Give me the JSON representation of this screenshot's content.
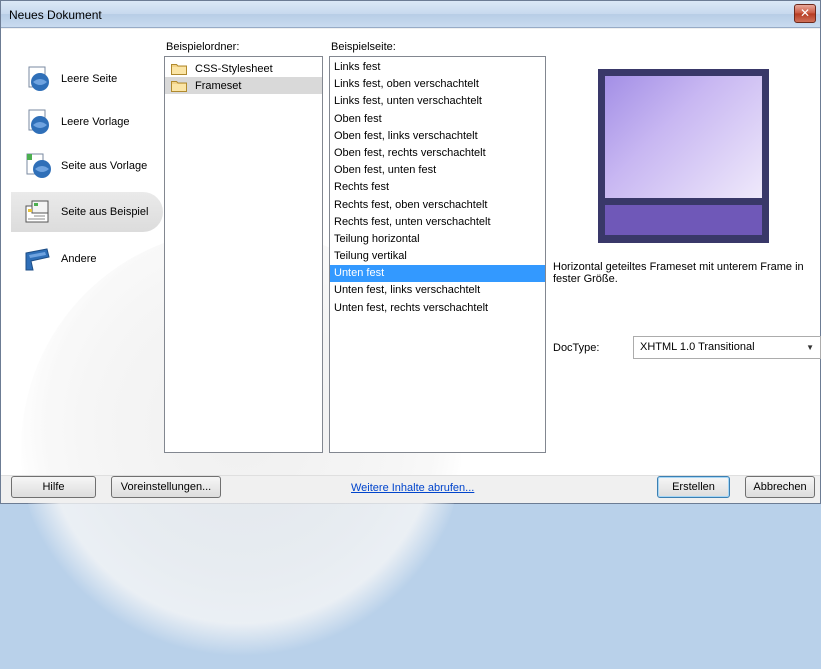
{
  "window": {
    "title": "Neues Dokument",
    "close_label": "✕"
  },
  "categories": [
    {
      "label": "Leere Seite",
      "icon": "blank-page-icon",
      "selected": false
    },
    {
      "label": "Leere Vorlage",
      "icon": "blank-template-icon",
      "selected": false
    },
    {
      "label": "Seite aus Vorlage",
      "icon": "page-from-template-icon",
      "selected": false
    },
    {
      "label": "Seite aus Beispiel",
      "icon": "page-from-sample-icon",
      "selected": true
    },
    {
      "label": "Andere",
      "icon": "other-icon",
      "selected": false
    }
  ],
  "sample_folder": {
    "label": "Beispielordner:",
    "items": [
      {
        "label": "CSS-Stylesheet",
        "selected": false
      },
      {
        "label": "Frameset",
        "selected": true
      }
    ]
  },
  "sample_page": {
    "label": "Beispielseite:",
    "items": [
      "Links fest",
      "Links fest, oben verschachtelt",
      "Links fest, unten verschachtelt",
      "Oben fest",
      "Oben fest, links verschachtelt",
      "Oben fest, rechts verschachtelt",
      "Oben fest, unten fest",
      "Rechts fest",
      "Rechts fest, oben verschachtelt",
      "Rechts fest, unten verschachtelt",
      "Teilung horizontal",
      "Teilung vertikal",
      "Unten fest",
      "Unten fest, links verschachtelt",
      "Unten fest, rechts verschachtelt"
    ],
    "selected_index": 12
  },
  "preview": {
    "description": "Horizontal geteiltes Frameset mit unterem Frame in fester Größe."
  },
  "doctype": {
    "label": "DocType:",
    "value": "XHTML 1.0 Transitional"
  },
  "footer": {
    "help_label": "Hilfe",
    "preferences_label": "Voreinstellungen...",
    "more_content_label": "Weitere Inhalte abrufen...",
    "create_label": "Erstellen",
    "cancel_label": "Abbrechen"
  }
}
